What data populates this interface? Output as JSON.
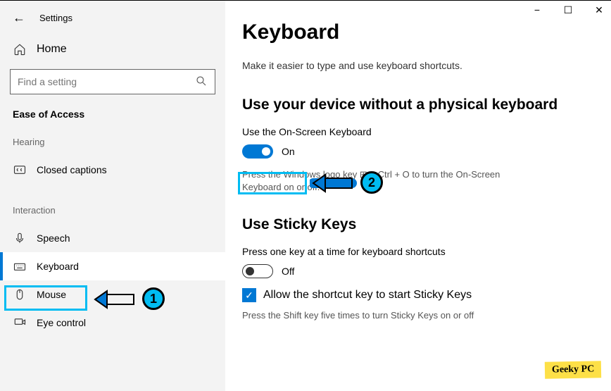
{
  "window": {
    "app_title": "Settings",
    "minimize": "−",
    "maximize": "☐",
    "close": "✕"
  },
  "sidebar": {
    "back_arrow": "←",
    "home_label": "Home",
    "search_placeholder": "Find a setting",
    "category": "Ease of Access",
    "group_hearing": "Hearing",
    "group_interaction": "Interaction",
    "items": {
      "closed_captions": "Closed captions",
      "speech": "Speech",
      "keyboard": "Keyboard",
      "mouse": "Mouse",
      "eye_control": "Eye control"
    }
  },
  "main": {
    "title": "Keyboard",
    "subtitle": "Make it easier to type and use keyboard shortcuts.",
    "section1": {
      "header": "Use your device without a physical keyboard",
      "label": "Use the On-Screen Keyboard",
      "toggle_state": "On",
      "help": "Press the Windows logo key ⊞ + Ctrl + O to turn the On-Screen Keyboard on or off."
    },
    "section2": {
      "header": "Use Sticky Keys",
      "label": "Press one key at a time for keyboard shortcuts",
      "toggle_state": "Off",
      "checkbox_label": "Allow the shortcut key to start Sticky Keys",
      "help": "Press the Shift key five times to turn Sticky Keys on or off"
    }
  },
  "annotations": {
    "callout1": "1",
    "callout2": "2"
  },
  "watermark": "Geeky PC"
}
